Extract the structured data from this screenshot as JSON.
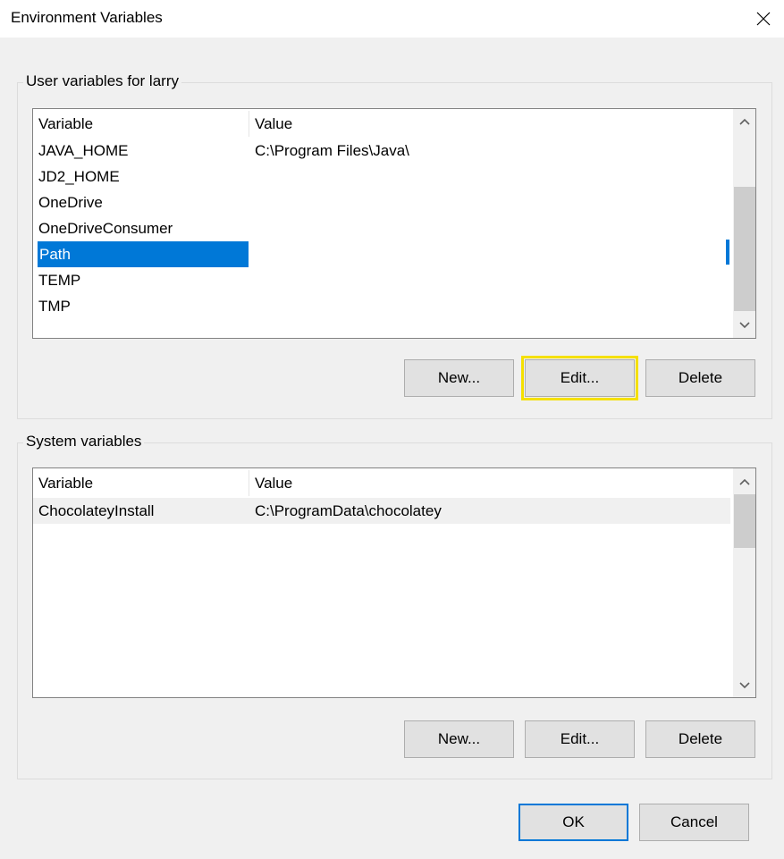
{
  "window": {
    "title": "Environment Variables"
  },
  "user_group": {
    "label": "User variables for larry",
    "columns": {
      "variable": "Variable",
      "value": "Value"
    },
    "rows": [
      {
        "variable": "JAVA_HOME",
        "value": "C:\\Program Files\\Java\\"
      },
      {
        "variable": "JD2_HOME",
        "value": ""
      },
      {
        "variable": "OneDrive",
        "value": ""
      },
      {
        "variable": "OneDriveConsumer",
        "value": ""
      },
      {
        "variable": "Path",
        "value": "",
        "selected": true
      },
      {
        "variable": "TEMP",
        "value": ""
      },
      {
        "variable": "TMP",
        "value": ""
      }
    ],
    "buttons": {
      "new": "New...",
      "edit": "Edit...",
      "delete": "Delete"
    }
  },
  "system_group": {
    "label": "System variables",
    "columns": {
      "variable": "Variable",
      "value": "Value"
    },
    "rows": [
      {
        "variable": "ChocolateyInstall",
        "value": "C:\\ProgramData\\chocolatey"
      }
    ],
    "buttons": {
      "new": "New...",
      "edit": "Edit...",
      "delete": "Delete"
    }
  },
  "footer": {
    "ok": "OK",
    "cancel": "Cancel"
  },
  "icons": {
    "close": "close-icon",
    "scroll_up": "chevron-up-icon",
    "scroll_down": "chevron-down-icon"
  },
  "colors": {
    "selection": "#0078d7",
    "highlight_outline": "#f5e000",
    "dialog_bg": "#f0f0f0",
    "button_bg": "#e1e1e1"
  }
}
